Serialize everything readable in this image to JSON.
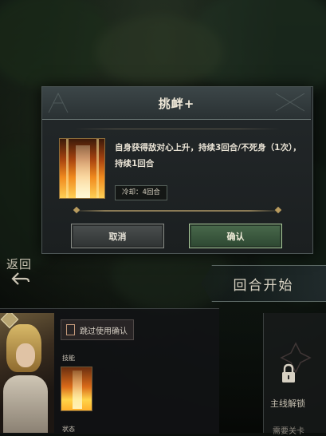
{
  "background": {
    "back_label": "返回",
    "round_start_label": "回合开始"
  },
  "bottom_panel": {
    "skip_confirm_label": "跳过使用确认",
    "skill_section_label": "技能",
    "bottom_section_label": "状态"
  },
  "lock_card": {
    "label": "主线解锁",
    "sub_label": "需要关卡"
  },
  "dialog": {
    "title": "挑衅+",
    "description": "自身获得敌对心上升，持续3回合/不死身（1次），持续1回合",
    "cooldown": "冷却：4回合",
    "cancel_label": "取消",
    "confirm_label": "确认"
  },
  "colors": {
    "confirm_green": "#2d4731",
    "cancel_gray": "#2f3333",
    "gold_accent": "#b89b5e"
  },
  "icons": {
    "back": "back-arrow-icon",
    "lock": "lock-icon",
    "skill": "fire-pillar-skill-icon"
  }
}
